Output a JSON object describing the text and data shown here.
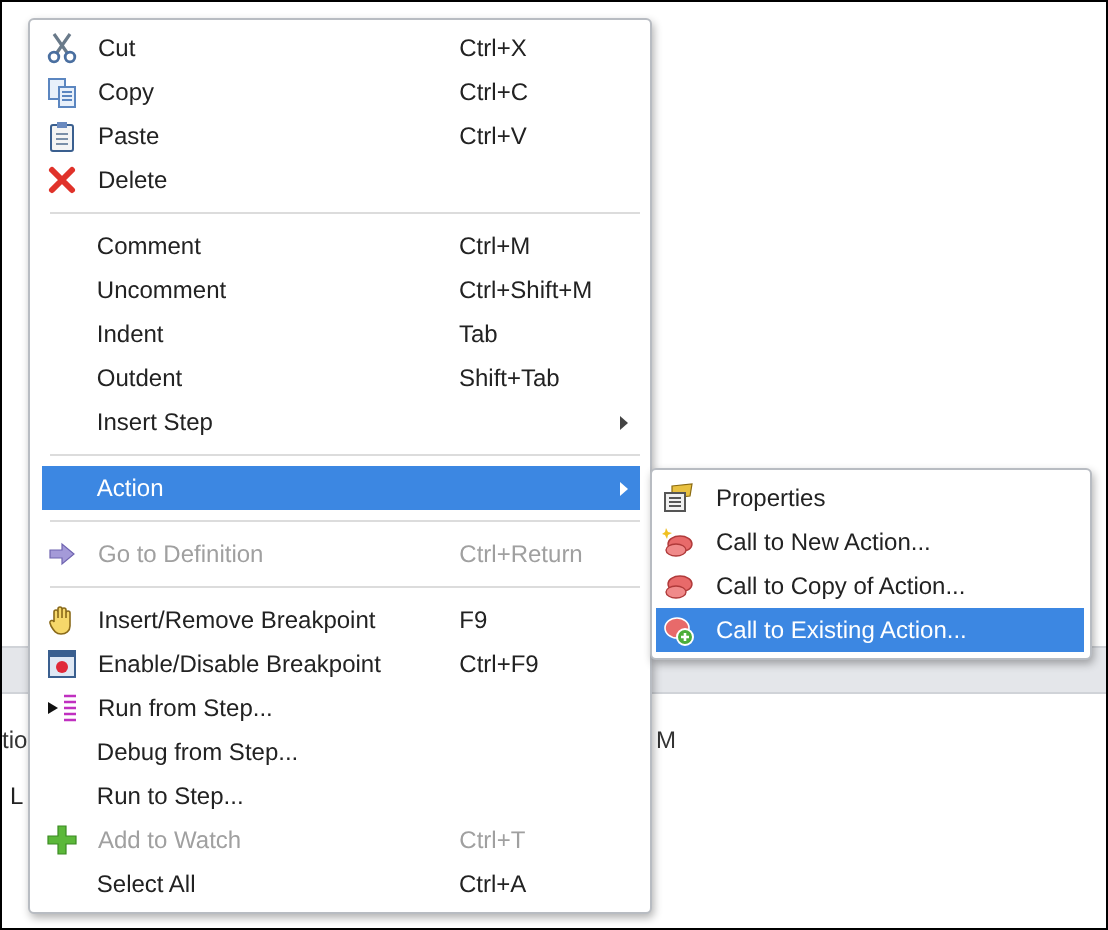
{
  "background": {
    "fragments": [
      {
        "text": "tio"
      },
      {
        "text": "L"
      },
      {
        "text": "M"
      }
    ]
  },
  "menu": {
    "items": [
      {
        "kind": "item",
        "label": "Cut",
        "shortcut": "Ctrl+X",
        "disabled": false,
        "selected": false,
        "has_submenu": false
      },
      {
        "kind": "item",
        "label": "Copy",
        "shortcut": "Ctrl+C",
        "disabled": false,
        "selected": false,
        "has_submenu": false
      },
      {
        "kind": "item",
        "label": "Paste",
        "shortcut": "Ctrl+V",
        "disabled": false,
        "selected": false,
        "has_submenu": false
      },
      {
        "kind": "item",
        "label": "Delete",
        "disabled": false,
        "selected": false,
        "has_submenu": false
      },
      {
        "kind": "separator"
      },
      {
        "kind": "item",
        "label": "Comment",
        "shortcut": "Ctrl+M",
        "disabled": false,
        "selected": false,
        "has_submenu": false
      },
      {
        "kind": "item",
        "label": "Uncomment",
        "shortcut": "Ctrl+Shift+M",
        "disabled": false,
        "selected": false,
        "has_submenu": false
      },
      {
        "kind": "item",
        "label": "Indent",
        "shortcut": "Tab",
        "disabled": false,
        "selected": false,
        "has_submenu": false
      },
      {
        "kind": "item",
        "label": "Outdent",
        "shortcut": "Shift+Tab",
        "disabled": false,
        "selected": false,
        "has_submenu": false
      },
      {
        "kind": "item",
        "label": "Insert Step",
        "disabled": false,
        "selected": false,
        "has_submenu": true
      },
      {
        "kind": "separator"
      },
      {
        "kind": "item",
        "label": "Action",
        "disabled": false,
        "selected": true,
        "has_submenu": true
      },
      {
        "kind": "separator"
      },
      {
        "kind": "item",
        "label": "Go to Definition",
        "shortcut": "Ctrl+Return",
        "disabled": true,
        "selected": false,
        "has_submenu": false
      },
      {
        "kind": "separator"
      },
      {
        "kind": "item",
        "label": "Insert/Remove Breakpoint",
        "shortcut": "F9",
        "disabled": false,
        "selected": false,
        "has_submenu": false
      },
      {
        "kind": "item",
        "label": "Enable/Disable Breakpoint",
        "shortcut": "Ctrl+F9",
        "disabled": false,
        "selected": false,
        "has_submenu": false
      },
      {
        "kind": "item",
        "label": "Run from Step...",
        "disabled": false,
        "selected": false,
        "has_submenu": false
      },
      {
        "kind": "item",
        "label": "Debug from Step...",
        "disabled": false,
        "selected": false,
        "has_submenu": false
      },
      {
        "kind": "item",
        "label": "Run to Step...",
        "disabled": false,
        "selected": false,
        "has_submenu": false
      },
      {
        "kind": "item",
        "label": "Add to Watch",
        "shortcut": "Ctrl+T",
        "disabled": true,
        "selected": false,
        "has_submenu": false
      },
      {
        "kind": "item",
        "label": "Select All",
        "shortcut": "Ctrl+A",
        "disabled": false,
        "selected": false,
        "has_submenu": false
      }
    ]
  },
  "submenu": {
    "items": [
      {
        "label": "Properties",
        "selected": false
      },
      {
        "label": "Call to New Action...",
        "selected": false
      },
      {
        "label": "Call to Copy of Action...",
        "selected": false
      },
      {
        "label": "Call to Existing Action...",
        "selected": true
      }
    ]
  }
}
